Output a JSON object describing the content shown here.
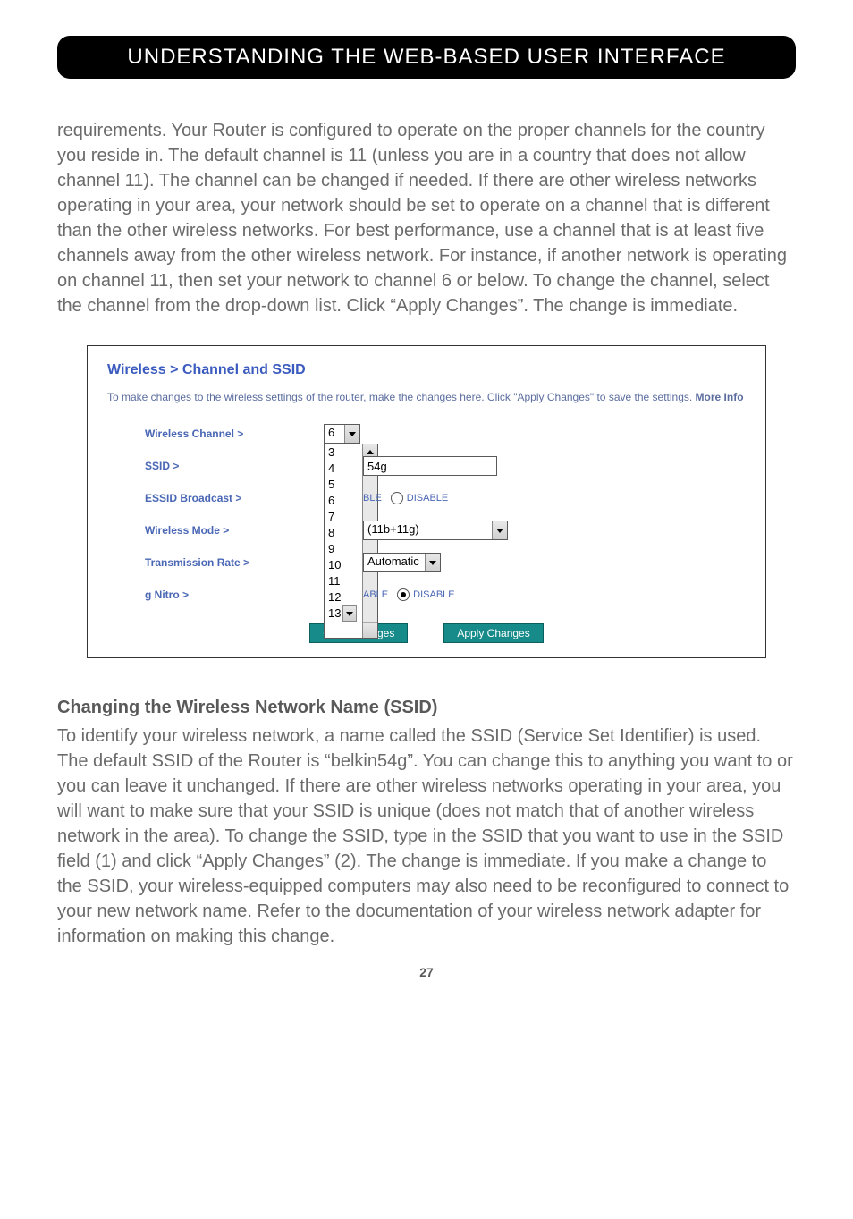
{
  "header": {
    "title": "UNDERSTANDING THE WEB-BASED USER INTERFACE"
  },
  "para1": "requirements. Your Router is configured to operate on the proper channels for the country you reside in. The default channel is 11 (unless you are in a country that does not allow channel 11). The channel can be changed if needed. If there are other wireless networks operating in your area, your network should be set to operate on a channel that is different than the other wireless networks. For best performance, use a channel that is at least five channels away from the other wireless network. For instance, if another network is operating on channel 11, then set your network to channel 6 or below. To change the channel, select the channel from the drop-down list. Click “Apply Changes”. The change is immediate.",
  "panel": {
    "title": "Wireless > Channel and SSID",
    "intro_a": "To make changes to the wireless settings of the router, make the changes here. Click \"Apply Changes\" to save the settings. ",
    "intro_more": "More Info",
    "labels": {
      "channel": "Wireless Channel >",
      "ssid": "SSID >",
      "essid": "ESSID Broadcast >",
      "mode": "Wireless Mode >",
      "rate": "Transmission Rate >",
      "nitro": "g Nitro >"
    },
    "channel_selected": "6",
    "channel_options": [
      "3",
      "4",
      "5",
      "6",
      "7",
      "8",
      "9",
      "10",
      "11",
      "12",
      "13"
    ],
    "last_option_visible": "13",
    "ssid_value": "54g",
    "essid_enable": "BLE",
    "essid_disable": "DISABLE",
    "mode_value": "(11b+11g)",
    "rate_value": "Automatic",
    "nitro_able": "ABLE",
    "nitro_disable": "DISABLE",
    "buttons": {
      "clear": "Clear Changes",
      "apply": "Apply Changes"
    }
  },
  "section2": {
    "heading": "Changing the Wireless Network Name (SSID)",
    "body": "To identify your wireless network, a name called the SSID (Service Set Identifier) is used. The default SSID of the Router is “belkin54g”. You can change this to anything you want to or you can leave it unchanged. If there are other wireless networks operating in your area, you will want to make sure that your SSID is unique (does not match that of another wireless network in the area). To change the SSID, type in the SSID that you want to use in the SSID field (1) and click “Apply Changes” (2). The change is immediate. If you make a change to the SSID, your wireless-equipped computers may also need to be reconfigured to connect to your new network name. Refer to the documentation of your wireless network adapter for information on making this change."
  },
  "page_number": "27"
}
